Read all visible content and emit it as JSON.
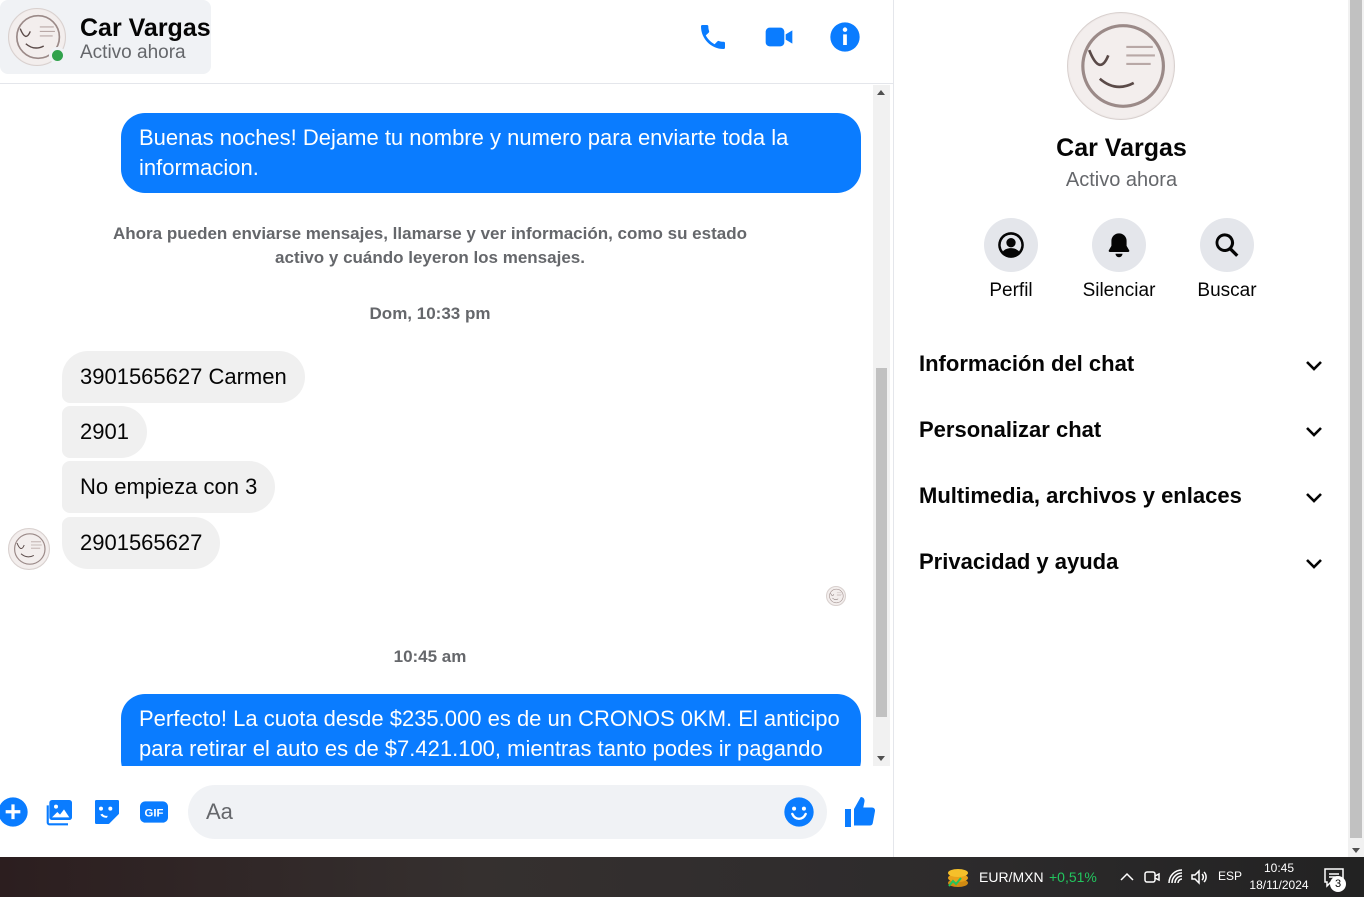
{
  "contact": {
    "name": "Car Vargas",
    "status": "Activo ahora"
  },
  "header_icons": [
    "phone-icon",
    "video-camera-icon",
    "info-icon"
  ],
  "messages": {
    "outgoing_1": "Buenas noches! Dejame tu nombre y numero para enviarte toda la informacion.",
    "system_note": "Ahora pueden enviarse mensajes, llamarse y ver información, como su estado activo y cuándo leyeron los mensajes.",
    "timestamp_1": "Dom, 10:33 pm",
    "incoming": [
      "3901565627 Carmen",
      "2901",
      "No empieza con 3",
      "2901565627"
    ],
    "timestamp_2": "10:45 am",
    "outgoing_2": "Perfecto! La cuota desde $235.000 es de un CRONOS 0KM. El anticipo para retirar el auto es de $7.421.100, mientras tanto podes ir pagando"
  },
  "composer": {
    "placeholder": "Aa"
  },
  "info_panel": {
    "name": "Car Vargas",
    "status": "Activo ahora",
    "actions": [
      {
        "label": "Perfil",
        "icon": "profile-icon"
      },
      {
        "label": "Silenciar",
        "icon": "bell-icon"
      },
      {
        "label": "Buscar",
        "icon": "search-icon"
      }
    ],
    "sections": [
      "Información del chat",
      "Personalizar chat",
      "Multimedia, archivos y enlaces",
      "Privacidad y ayuda"
    ]
  },
  "taskbar": {
    "currency_pair": "EUR/MXN",
    "currency_change": "+0,51%",
    "language": "ESP",
    "time": "10:45",
    "date": "18/11/2024",
    "notification_count": "3"
  },
  "colors": {
    "accent": "#0a7cff",
    "incoming_bubble": "#f0f0f0",
    "online": "#31a24c",
    "positive_change": "#22c55e"
  }
}
